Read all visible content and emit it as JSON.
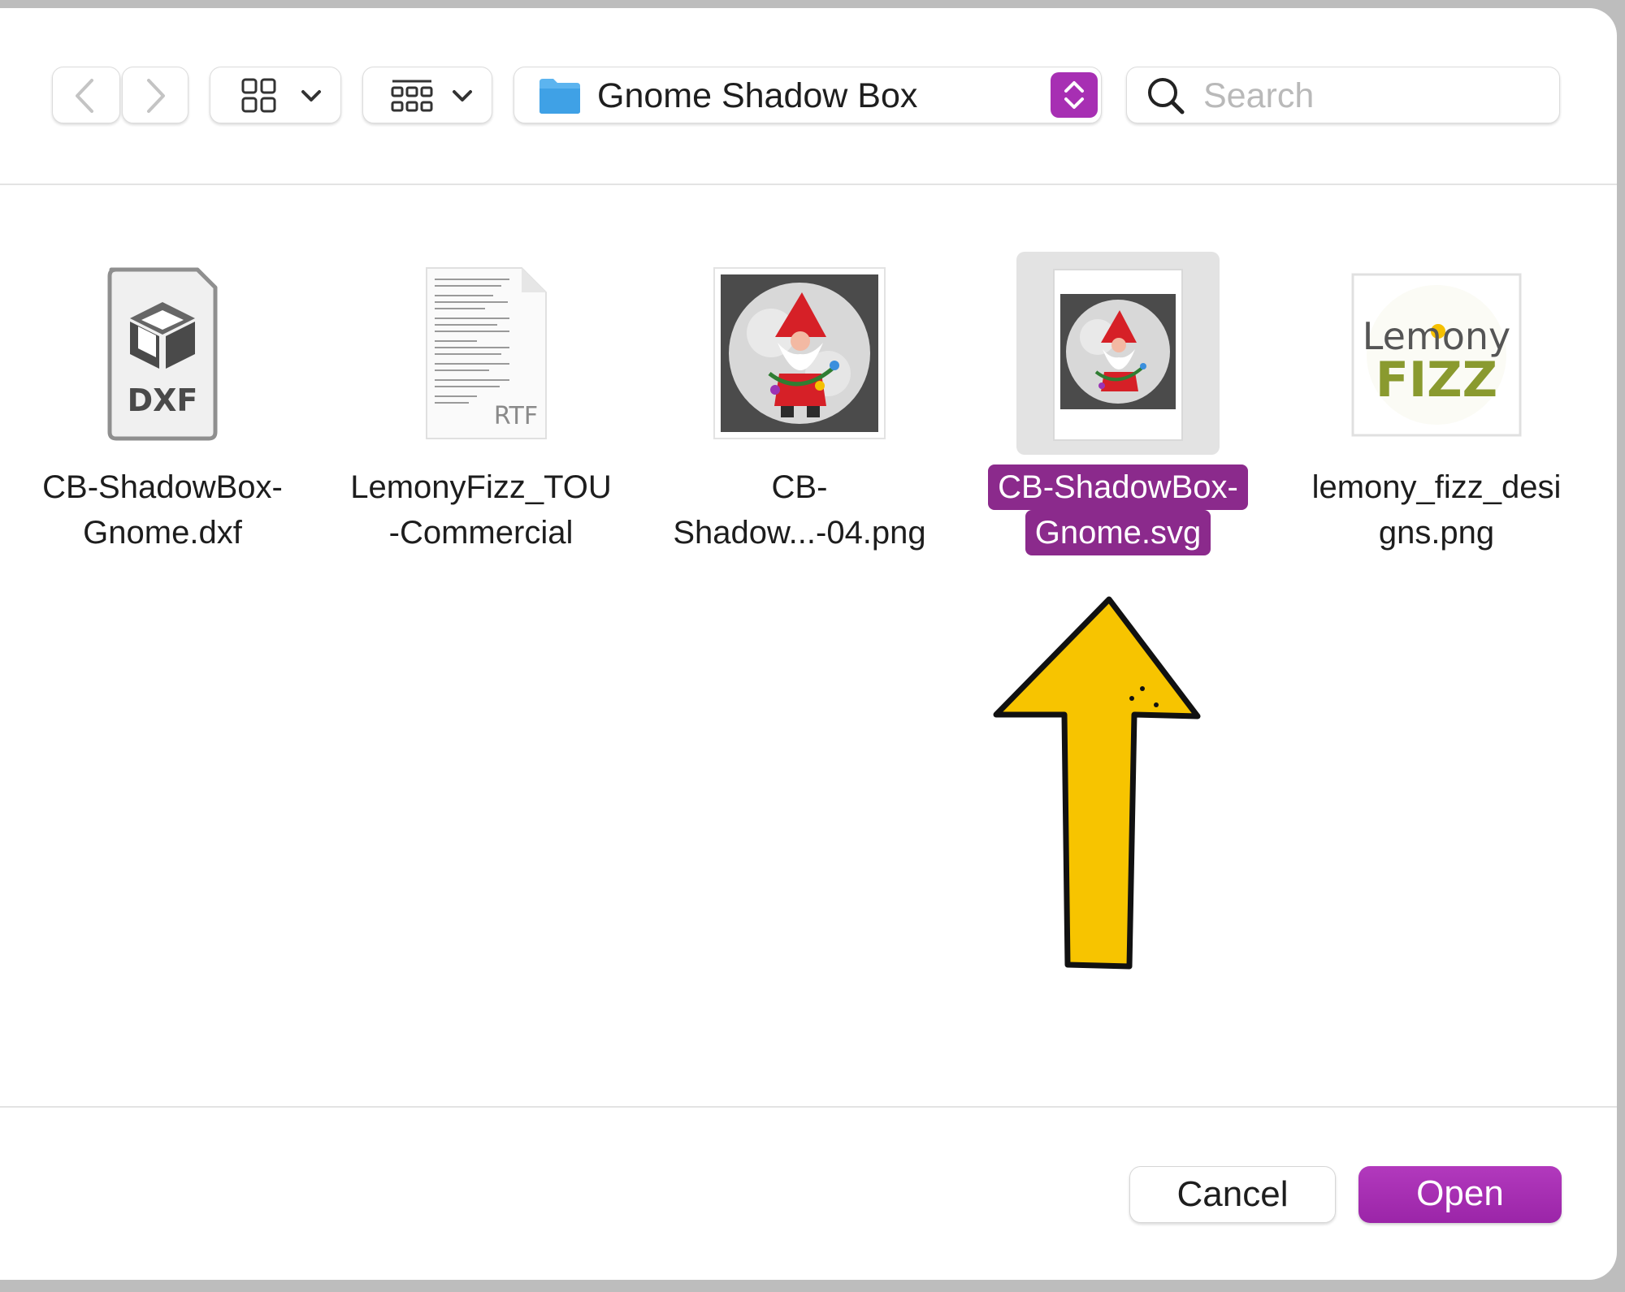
{
  "toolbar": {
    "back_icon": "chevron-left-icon",
    "forward_icon": "chevron-right-icon",
    "view_icon": "icon-grid-view-icon",
    "group_icon": "group-by-icon",
    "path_folder_icon": "folder-icon",
    "path_label": "Gnome Shadow Box",
    "search_placeholder": "Search"
  },
  "files": [
    {
      "name_line1": "CB-ShadowBox-",
      "name_line2": "Gnome.dxf",
      "kind": "DXF",
      "selected": false
    },
    {
      "name_line1": "LemonyFizz_TOU",
      "name_line2": "-Commercial",
      "kind": "RTF",
      "selected": false
    },
    {
      "name_line1": "CB-",
      "name_line2": "Shadow...-04.png",
      "kind": "png",
      "selected": false
    },
    {
      "name_line1": "CB-ShadowBox-",
      "name_line2": "Gnome.svg",
      "kind": "svg",
      "selected": true
    },
    {
      "name_line1": "lemony_fizz_desi",
      "name_line2": "gns.png",
      "kind": "png",
      "selected": false
    }
  ],
  "logo": {
    "line1": "Lemony",
    "line2": "FIZZ"
  },
  "buttons": {
    "cancel": "Cancel",
    "open": "Open"
  },
  "colors": {
    "accent": "#8b2a8c",
    "open_button": "#a730b2",
    "arrow_fill": "#f7c400"
  }
}
